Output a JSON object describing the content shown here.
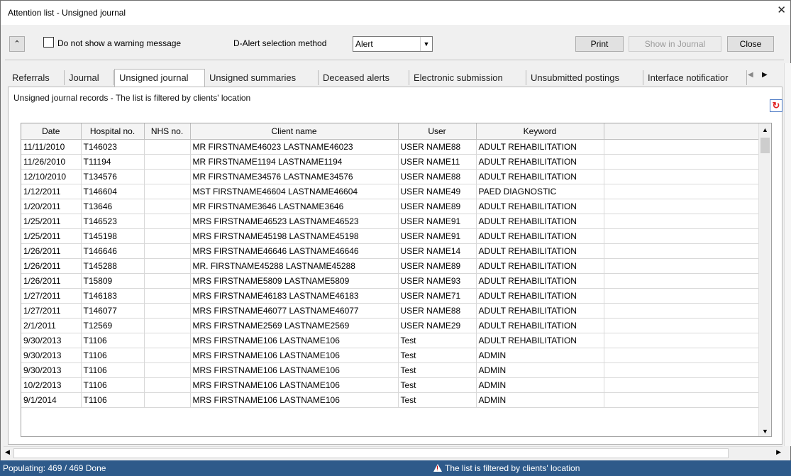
{
  "window": {
    "title": "Attention list - Unsigned journal",
    "close_glyph": "✕"
  },
  "toolbar": {
    "collapse_glyph": "⌃",
    "no_warning_label": "Do not show a warning message",
    "alert_method_label": "D-Alert selection method",
    "alert_method_value": "Alert",
    "print_label": "Print",
    "show_in_journal_label": "Show in Journal",
    "close_label": "Close"
  },
  "tabs": [
    {
      "label": "Referrals"
    },
    {
      "label": "Journal"
    },
    {
      "label": "Unsigned journal"
    },
    {
      "label": "Unsigned summaries"
    },
    {
      "label": "Deceased alerts"
    },
    {
      "label": "Electronic submission"
    },
    {
      "label": "Unsubmitted postings"
    },
    {
      "label": "Interface notificatior"
    }
  ],
  "active_tab": "Unsigned journal",
  "panel": {
    "caption": "Unsigned journal records - The list is filtered by clients' location"
  },
  "table": {
    "columns": [
      "Date",
      "Hospital no.",
      "NHS no.",
      "Client name",
      "User",
      "Keyword"
    ],
    "rows": [
      [
        "11/11/2010",
        "T146023",
        "",
        "MR FIRSTNAME46023 LASTNAME46023",
        "USER NAME88",
        "ADULT REHABILITATION"
      ],
      [
        "11/26/2010",
        "T11194",
        "",
        "MR FIRSTNAME1194 LASTNAME1194",
        "USER NAME11",
        "ADULT REHABILITATION"
      ],
      [
        "12/10/2010",
        "T134576",
        "",
        "MR FIRSTNAME34576 LASTNAME34576",
        "USER NAME88",
        "ADULT REHABILITATION"
      ],
      [
        "1/12/2011",
        "T146604",
        "",
        "MST FIRSTNAME46604 LASTNAME46604",
        "USER NAME49",
        "PAED DIAGNOSTIC"
      ],
      [
        "1/20/2011",
        "T13646",
        "",
        "MR FIRSTNAME3646 LASTNAME3646",
        "USER NAME89",
        "ADULT REHABILITATION"
      ],
      [
        "1/25/2011",
        "T146523",
        "",
        "MRS FIRSTNAME46523 LASTNAME46523",
        "USER NAME91",
        "ADULT REHABILITATION"
      ],
      [
        "1/25/2011",
        "T145198",
        "",
        "MRS FIRSTNAME45198 LASTNAME45198",
        "USER NAME91",
        "ADULT REHABILITATION"
      ],
      [
        "1/26/2011",
        "T146646",
        "",
        "MRS FIRSTNAME46646 LASTNAME46646",
        "USER NAME14",
        "ADULT REHABILITATION"
      ],
      [
        "1/26/2011",
        "T145288",
        "",
        "MR. FIRSTNAME45288 LASTNAME45288",
        "USER NAME89",
        "ADULT REHABILITATION"
      ],
      [
        "1/26/2011",
        "T15809",
        "",
        "MRS FIRSTNAME5809 LASTNAME5809",
        "USER NAME93",
        "ADULT REHABILITATION"
      ],
      [
        "1/27/2011",
        "T146183",
        "",
        "MRS FIRSTNAME46183 LASTNAME46183",
        "USER NAME71",
        "ADULT REHABILITATION"
      ],
      [
        "1/27/2011",
        "T146077",
        "",
        "MRS FIRSTNAME46077 LASTNAME46077",
        "USER NAME88",
        "ADULT REHABILITATION"
      ],
      [
        "2/1/2011",
        "T12569",
        "",
        "MRS FIRSTNAME2569 LASTNAME2569",
        "USER NAME29",
        "ADULT REHABILITATION"
      ],
      [
        "9/30/2013",
        "T1106",
        "",
        "MRS FIRSTNAME106 LASTNAME106",
        "Test",
        "ADULT REHABILITATION"
      ],
      [
        "9/30/2013",
        "T1106",
        "",
        "MRS FIRSTNAME106 LASTNAME106",
        "Test",
        "ADMIN"
      ],
      [
        "9/30/2013",
        "T1106",
        "",
        "MRS FIRSTNAME106 LASTNAME106",
        "Test",
        "ADMIN"
      ],
      [
        "10/2/2013",
        "T1106",
        "",
        "MRS FIRSTNAME106 LASTNAME106",
        "Test",
        "ADMIN"
      ],
      [
        "9/1/2014",
        "T1106",
        "",
        "MRS FIRSTNAME106 LASTNAME106",
        "Test",
        "ADMIN"
      ]
    ]
  },
  "status": {
    "left": "Populating: 469 / 469 Done",
    "right": "The list is filtered by clients' location",
    "bg_color": "#2e5a8a"
  },
  "icons": {
    "refresh": "refresh-icon",
    "warning": "warning-icon"
  }
}
